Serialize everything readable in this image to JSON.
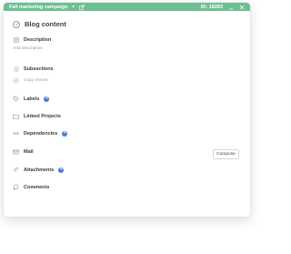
{
  "header": {
    "project": "Fall marketing campaign",
    "id_label": "ID: 18283",
    "bg_color": "#6cbf92"
  },
  "task": {
    "title": "Blog content"
  },
  "description": {
    "label": "Description",
    "placeholder": "Add description"
  },
  "subsections": {
    "label": "Subsections",
    "item": "Copy review"
  },
  "labels": {
    "label": "Labels"
  },
  "linked_projects": {
    "label": "Linked Projects"
  },
  "dependencies": {
    "label": "Dependencies"
  },
  "mail": {
    "label": "Mail",
    "compose": "Compose"
  },
  "attachments": {
    "label": "Attachments"
  },
  "comments": {
    "label": "Comments"
  },
  "icons": [
    "chevron-down-icon",
    "edit-icon",
    "minimize-icon",
    "close-icon",
    "check-icon",
    "description-icon",
    "subsections-icon",
    "tag-icon",
    "folder-icon",
    "dependency-icon",
    "mail-icon",
    "paperclip-icon",
    "comment-icon",
    "plus-icon"
  ]
}
